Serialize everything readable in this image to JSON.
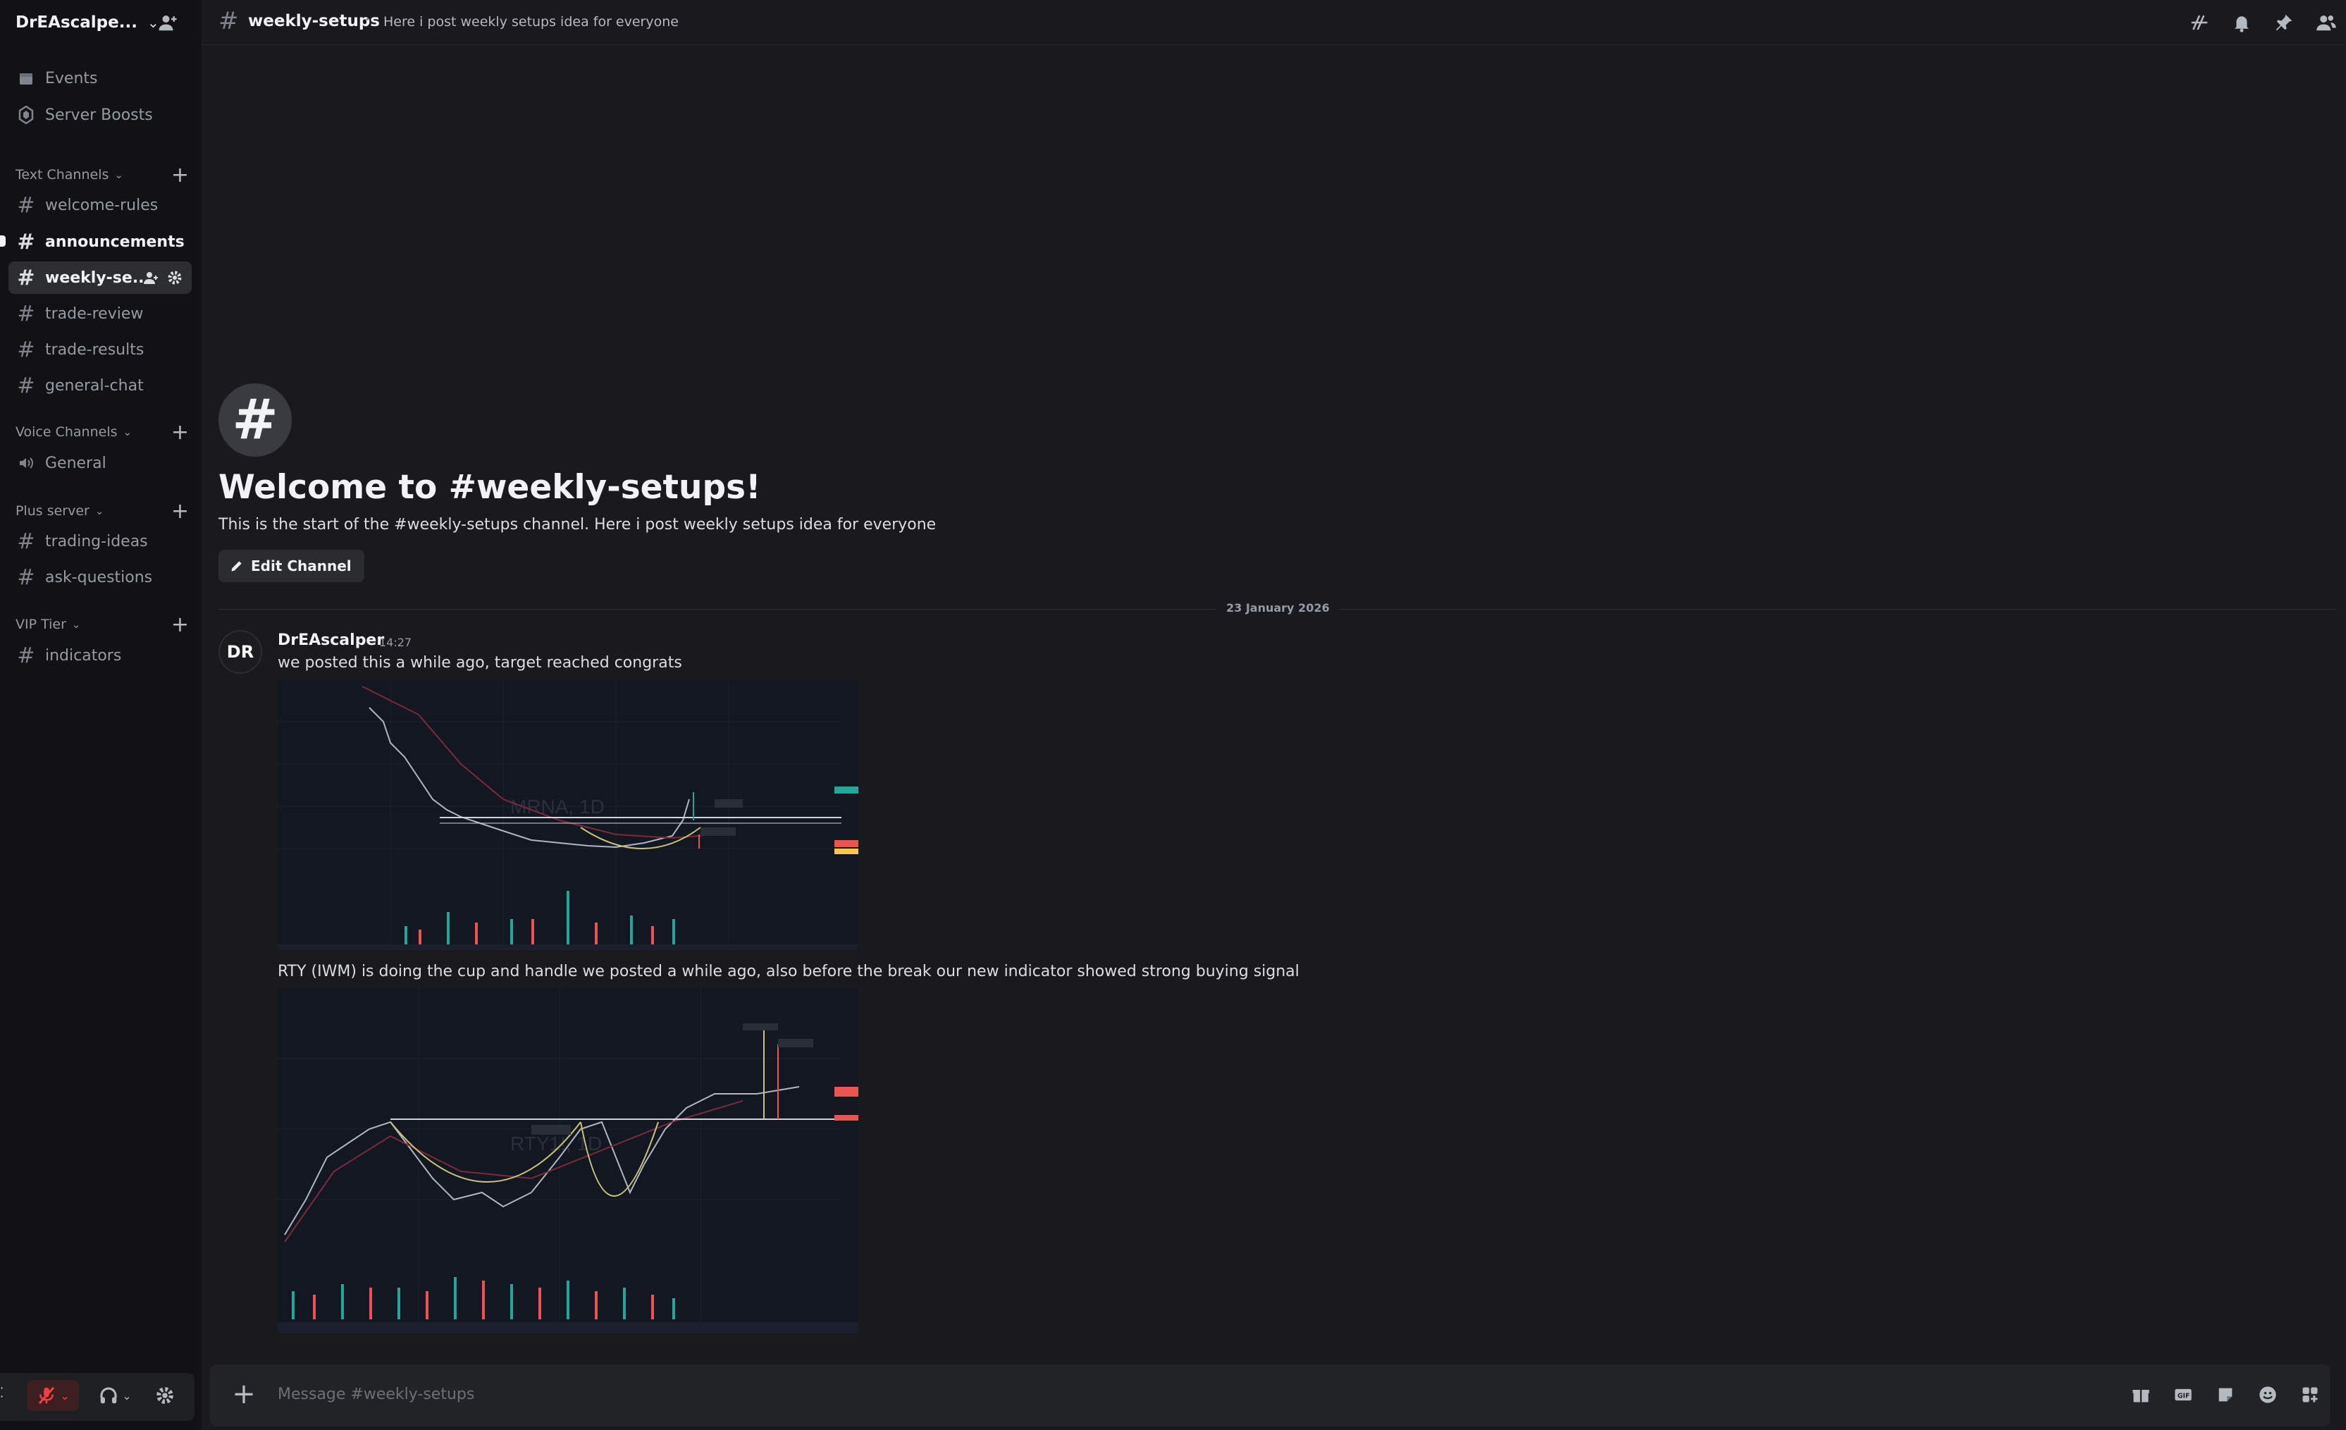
{
  "server": {
    "name": "DrEAscalpe..."
  },
  "sidebar": {
    "top_items": [
      {
        "label": "Events",
        "icon": "calendar-icon"
      },
      {
        "label": "Server Boosts",
        "icon": "boost-icon"
      }
    ],
    "categories": [
      {
        "label": "Text Channels"
      },
      {
        "label": "Voice Channels"
      },
      {
        "label": "Plus server"
      },
      {
        "label": "VIP Tier"
      }
    ],
    "channels": [
      {
        "label": "welcome-rules"
      },
      {
        "label": "announcements"
      },
      {
        "label": "weekly-se..."
      },
      {
        "label": "trade-review"
      },
      {
        "label": "trade-results"
      },
      {
        "label": "general-chat"
      },
      {
        "label": "General"
      },
      {
        "label": "trading-ideas"
      },
      {
        "label": "ask-questions"
      },
      {
        "label": "indicators"
      }
    ]
  },
  "topbar": {
    "channel_name": "weekly-setups",
    "topic": "Here i post weekly setups idea for everyone"
  },
  "welcome": {
    "title": "Welcome to #weekly-setups!",
    "subtitle": "This is the start of the #weekly-setups channel. Here i post weekly setups idea for everyone",
    "edit_label": "Edit Channel"
  },
  "divider": {
    "date": "23 January 2026"
  },
  "message": {
    "avatar_text": "DR",
    "author": "DrEAscalper",
    "time": "14:27",
    "text1": "we posted this a while ago, target reached congrats",
    "chart1_label": "MRNA, 1D",
    "text2": "RTY (IWM) is doing the cup and handle we posted a while ago, also before the break our new indicator showed strong buying signal",
    "chart2_label": "RTY1!, 1D"
  },
  "composer": {
    "placeholder": "Message #weekly-setups"
  },
  "colors": {
    "background": "#1a1a1e",
    "sidebar": "#121214",
    "muted_mic": "#f23f43",
    "accent_green": "#26a69a",
    "accent_red": "#ef5350"
  }
}
